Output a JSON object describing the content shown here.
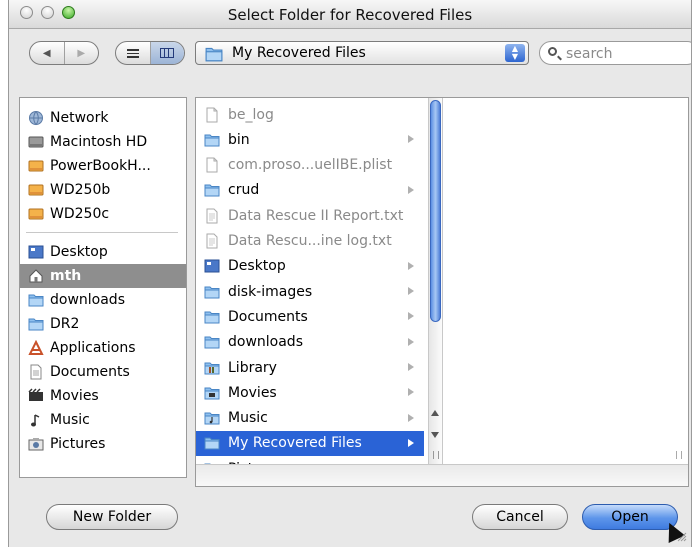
{
  "window": {
    "title": "Select Folder for Recovered Files"
  },
  "toolbar": {
    "back_icon": "back-arrow-icon",
    "forward_icon": "forward-arrow-icon",
    "view_list_icon": "list-view-icon",
    "view_column_icon": "column-view-icon",
    "location": "My Recovered Files",
    "search_placeholder": "search"
  },
  "sidebar": {
    "devices": [
      {
        "label": "Network",
        "icon": "network-globe-icon"
      },
      {
        "label": "Macintosh HD",
        "icon": "hard-drive-icon"
      },
      {
        "label": "PowerBookH...",
        "icon": "external-drive-icon"
      },
      {
        "label": "WD250b",
        "icon": "external-drive-icon"
      },
      {
        "label": "WD250c",
        "icon": "external-drive-icon"
      }
    ],
    "places": [
      {
        "label": "Desktop",
        "icon": "desktop-icon"
      },
      {
        "label": "mth",
        "icon": "home-icon",
        "selected": true
      },
      {
        "label": "downloads",
        "icon": "folder-icon"
      },
      {
        "label": "DR2",
        "icon": "folder-icon"
      },
      {
        "label": "Applications",
        "icon": "applications-icon"
      },
      {
        "label": "Documents",
        "icon": "documents-icon"
      },
      {
        "label": "Movies",
        "icon": "movies-icon"
      },
      {
        "label": "Music",
        "icon": "music-icon"
      },
      {
        "label": "Pictures",
        "icon": "pictures-icon"
      }
    ]
  },
  "browser": {
    "items": [
      {
        "label": "be_log",
        "type": "file",
        "dim": true
      },
      {
        "label": "bin",
        "type": "folder",
        "has_children": true
      },
      {
        "label": "com.proso...uelIBE.plist",
        "type": "file",
        "dim": true
      },
      {
        "label": "crud",
        "type": "folder",
        "has_children": true
      },
      {
        "label": "Data Rescue II Report.txt",
        "type": "file",
        "dim": true
      },
      {
        "label": "Data Rescu...ine log.txt",
        "type": "file",
        "dim": true
      },
      {
        "label": "Desktop",
        "type": "desktop",
        "has_children": true
      },
      {
        "label": "disk-images",
        "type": "folder",
        "has_children": true
      },
      {
        "label": "Documents",
        "type": "folder",
        "has_children": true
      },
      {
        "label": "downloads",
        "type": "folder",
        "has_children": true
      },
      {
        "label": "Library",
        "type": "library",
        "has_children": true
      },
      {
        "label": "Movies",
        "type": "movies",
        "has_children": true
      },
      {
        "label": "Music",
        "type": "music",
        "has_children": true
      },
      {
        "label": "My Recovered Files",
        "type": "folder",
        "has_children": true,
        "selected": true
      },
      {
        "label": "Pictures",
        "type": "folder",
        "has_children": true
      }
    ]
  },
  "buttons": {
    "new_folder": "New Folder",
    "cancel": "Cancel",
    "open": "Open"
  },
  "colors": {
    "selection": "#2a63d6",
    "sidebar_selection": "#8e8e8e",
    "default_button": "#5d95ea",
    "folder": "#79b0e6"
  }
}
